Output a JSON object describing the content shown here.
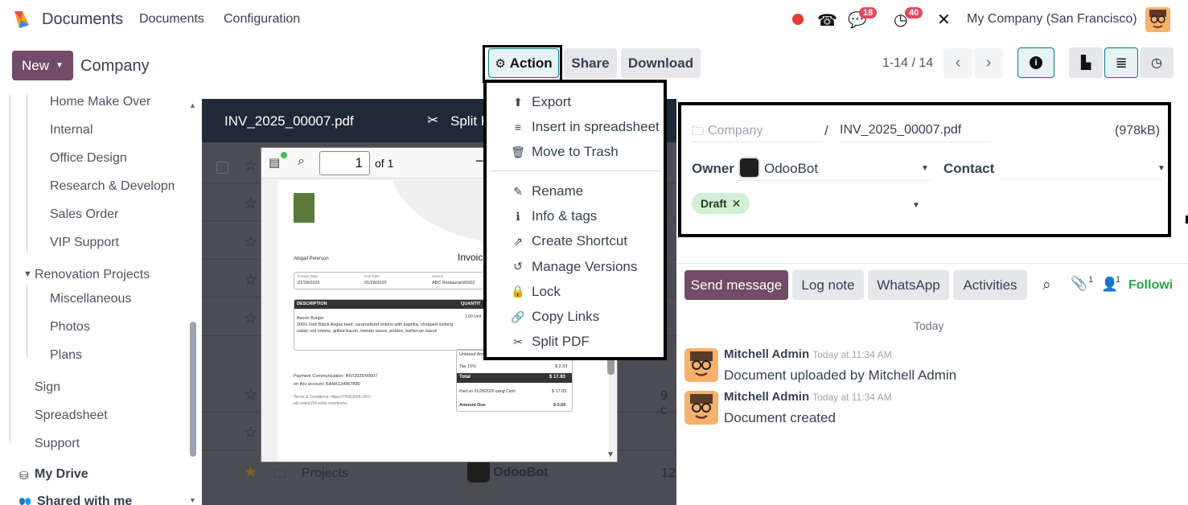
{
  "navbar": {
    "app_name": "Documents",
    "menu": [
      "Documents",
      "Configuration"
    ],
    "messages_count": "18",
    "activities_count": "40",
    "company": "My Company (San Francisco)"
  },
  "control": {
    "new_label": "New",
    "breadcrumb": "Company",
    "action_label": "Action",
    "share_label": "Share",
    "download_label": "Download",
    "pager": "1-14 / 14"
  },
  "sidebar": {
    "items": [
      "Home Make Over",
      "Internal",
      "Office Design",
      "Research & Developm",
      "Sales Order",
      "VIP Support"
    ],
    "renovation": "Renovation Projects",
    "renovation_items": [
      "Miscellaneous",
      "Photos",
      "Plans"
    ],
    "root_items": [
      "Sign",
      "Spreadsheet",
      "Support"
    ],
    "my_drive": "My Drive",
    "shared": "Shared with me"
  },
  "viewer": {
    "filename": "INV_2025_00007.pdf",
    "split_label": "Split P",
    "page_input": "1",
    "page_of": "of 1",
    "folder_row": "Projects",
    "folder_owner": "OdooBot",
    "folder_count": "12",
    "partial_count": "9 c"
  },
  "invoice": {
    "customer": "Abigail Peterson",
    "title": "Invoic",
    "invoice_date_label": "Invoice Date",
    "invoice_date": "01/28/2025",
    "due_date_label": "Due Date",
    "due_date": "01/28/2025",
    "source_label": "Source",
    "source": "ABC Restaurant/0002",
    "desc_header": "DESCRIPTION",
    "qty_header": "QUANTIT",
    "item_name": "Bacon Burger",
    "item_desc": "200G Irish Black Angus beef, caramelized onions with paprika, chopped iceberg salad, red onions, grilled bacon, tomato sauce, pickles, barbecue sauce",
    "qty": "1.00 Unit",
    "untaxed_label": "Untaxed Am",
    "tax_label": "Tax 15%",
    "tax_value": "$ 2.33",
    "total_label": "Total",
    "total_value": "$ 17.83",
    "paid_label": "Paid on 01/28/2025 using Cash",
    "paid_value": "$ 17.83",
    "amount_due_label": "Amount Due",
    "amount_due_value": "$ 0.00",
    "payment_comm": "Payment Communication: INV/2025/00007",
    "account": "on this account: BANK134567890",
    "terms": "Terms & Conditions: https://74063906-18-0-all.runbot154.odoo.com/terms"
  },
  "dropdown": {
    "items1": [
      {
        "icon": "upload-icon",
        "glyph": "⬆",
        "label": "Export"
      },
      {
        "icon": "list-icon",
        "glyph": "≡",
        "label": "Insert in spreadsheet"
      },
      {
        "icon": "trash-icon",
        "glyph": "🗑",
        "label": "Move to Trash"
      }
    ],
    "items2": [
      {
        "icon": "edit-icon",
        "glyph": "✎",
        "label": "Rename"
      },
      {
        "icon": "info-icon",
        "glyph": "ℹ",
        "label": "Info & tags"
      },
      {
        "icon": "external-link-icon",
        "glyph": "⇗",
        "label": "Create Shortcut"
      },
      {
        "icon": "history-icon",
        "glyph": "↺",
        "label": "Manage Versions"
      },
      {
        "icon": "lock-icon",
        "glyph": "🔒",
        "label": "Lock"
      },
      {
        "icon": "link-icon",
        "glyph": "🔗",
        "label": "Copy Links"
      },
      {
        "icon": "scissors-icon",
        "glyph": "✂",
        "label": "Split PDF"
      }
    ]
  },
  "details": {
    "folder": "Company",
    "separator": "/",
    "filename": "INV_2025_00007.pdf",
    "size": "(978kB)",
    "owner_label": "Owner",
    "owner": "OdooBot",
    "contact_label": "Contact",
    "tag": "Draft"
  },
  "chatter": {
    "send_message": "Send message",
    "log_note": "Log note",
    "whatsapp": "WhatsApp",
    "activities": "Activities",
    "attachments_count": "1",
    "followers_count": "1",
    "following": "Followi",
    "today": "Today",
    "messages": [
      {
        "author": "Mitchell Admin",
        "time": "Today at 11:34 AM",
        "body": "Document uploaded by Mitchell Admin"
      },
      {
        "author": "Mitchell Admin",
        "time": "Today at 11:34 AM",
        "body": "Document created"
      }
    ]
  },
  "colors": {
    "primary": "#714b67",
    "highlight_teal": "#e6f2f3",
    "dark_bg": "#4b4d52",
    "tag_green": "#d1f0d4",
    "following_green": "#28a745"
  }
}
